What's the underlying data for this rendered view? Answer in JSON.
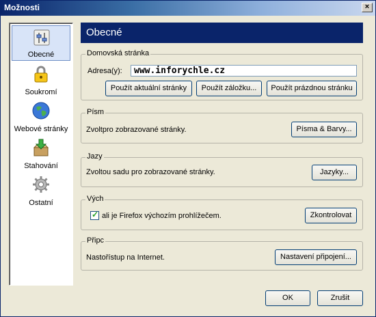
{
  "window": {
    "title": "Možnosti",
    "close_symbol": "×"
  },
  "sidebar": {
    "items": [
      {
        "label": "Obecné",
        "icon": "general-settings-icon",
        "selected": true
      },
      {
        "label": "Soukromí",
        "icon": "padlock-icon",
        "selected": false
      },
      {
        "label": "Webové stránky",
        "icon": "globe-icon",
        "selected": false
      },
      {
        "label": "Stahování",
        "icon": "download-box-icon",
        "selected": false
      },
      {
        "label": "Ostatní",
        "icon": "gear-icon",
        "selected": false
      }
    ]
  },
  "panel": {
    "title": "Obecné"
  },
  "homepage": {
    "legend": "Domovská stránka",
    "address_label": "Adresa(y):",
    "address_value": "www.inforychle.cz",
    "buttons": {
      "current": "Použít aktuální stránky",
      "bookmark": "Použít záložku...",
      "blank": "Použít prázdnou stránku"
    }
  },
  "fonts": {
    "legend": "Písm",
    "description": "Zvoltpro zobrazované stránky.",
    "button": "Písma & Barvy..."
  },
  "languages": {
    "legend": "Jazy",
    "description": "Zvoltou sadu pro zobrazované stránky.",
    "button": "Jazyky..."
  },
  "default_browser": {
    "legend": "Vých",
    "checkbox_label": "ali je Firefox výchozím prohlížečem.",
    "checked": true,
    "button": "Zkontrolovat"
  },
  "connection": {
    "legend": "Připc",
    "description": "Nastořístup na Internet.",
    "button": "Nastavení připojení..."
  },
  "footer": {
    "ok": "OK",
    "cancel": "Zrušit"
  },
  "colors": {
    "header_bg": "#0a246a",
    "window_bg": "#ece9d8",
    "selected_nav_bg": "#d8e4f8"
  }
}
